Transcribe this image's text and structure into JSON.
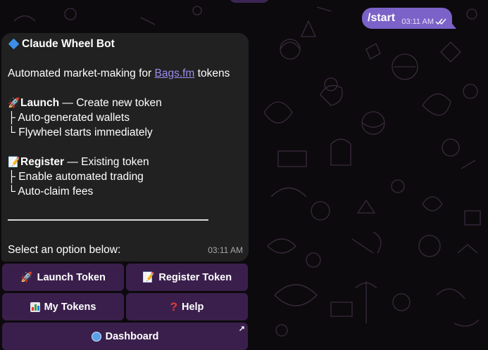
{
  "outgoing": {
    "text": "/start",
    "time": "03:11 AM",
    "status_icon": "double-check-icon"
  },
  "message": {
    "title": "Claude Wheel Bot",
    "title_icon": "blue-diamond-icon",
    "intro_prefix": "Automated market-making for ",
    "intro_link": "Bags.fm",
    "intro_suffix": " tokens",
    "launch": {
      "icon": "rocket-icon",
      "name": "Launch",
      "desc": " — Create new token",
      "items": [
        "├ Auto-generated wallets",
        "└ Flywheel starts immediately"
      ]
    },
    "register": {
      "icon": "memo-icon",
      "name": "Register",
      "desc": " — Existing token",
      "items": [
        "├ Enable automated trading",
        "└ Auto-claim fees"
      ]
    },
    "select_text": "Select an option below:",
    "time": "03:11 AM"
  },
  "keyboard": {
    "launch_token": "Launch Token",
    "register_token": "Register Token",
    "my_tokens": "My Tokens",
    "help": "Help",
    "dashboard": "Dashboard"
  },
  "colors": {
    "outgoing_bubble": "#7b62c8",
    "incoming_bubble": "#212121",
    "keyboard_button": "#3a1f4c",
    "link": "#9e8cf0",
    "background": "#0c0a0d"
  }
}
